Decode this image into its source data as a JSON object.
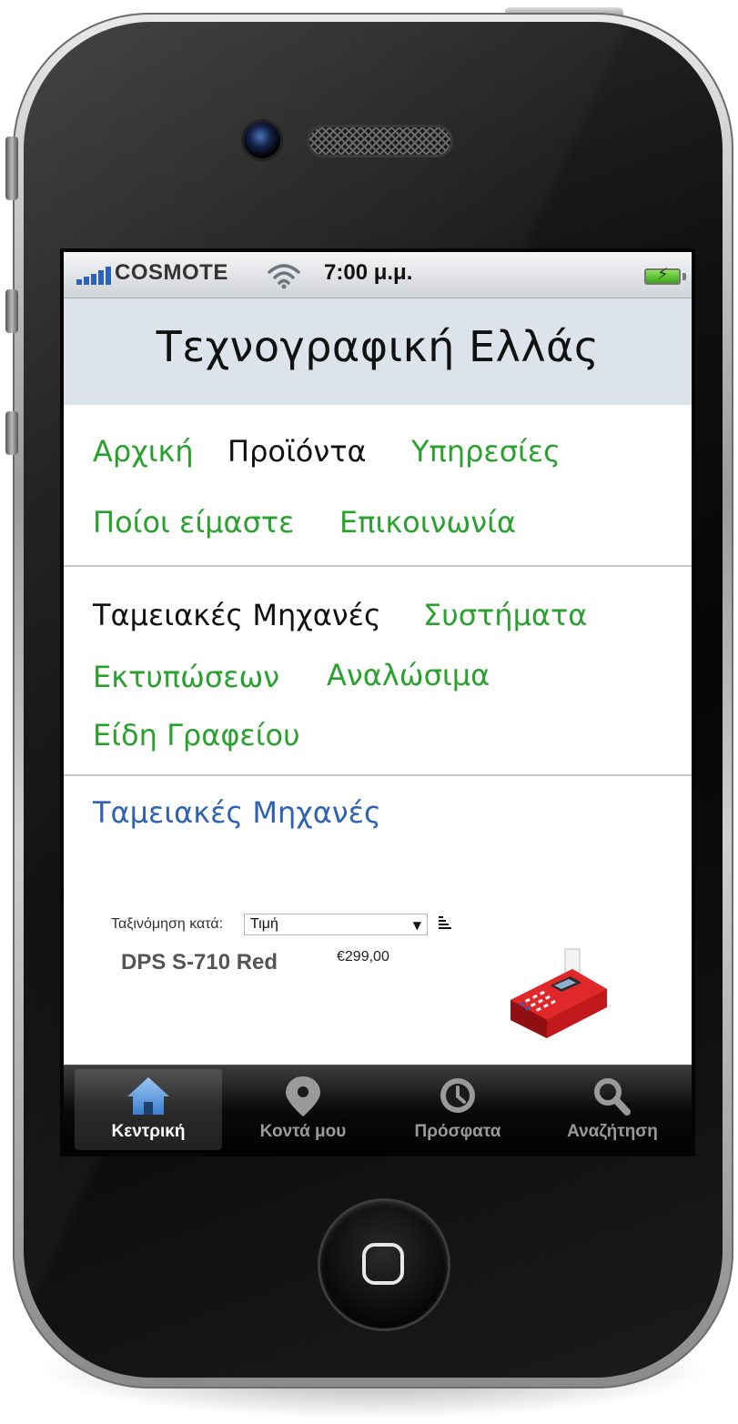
{
  "status_bar": {
    "carrier": "COSMOTE",
    "time": "7:00 μ.μ."
  },
  "header": {
    "title": "Τεχνογραφική Ελλάς"
  },
  "main_nav": [
    {
      "label": "Αρχική",
      "active": false
    },
    {
      "label": "Προϊόντα",
      "active": true
    },
    {
      "label": "Υπηρεσίες",
      "active": false
    },
    {
      "label": "Ποίοι είμαστε",
      "active": false
    },
    {
      "label": "Επικοινωνία",
      "active": false
    }
  ],
  "category_nav": [
    {
      "label": "Ταμειακές Μηχανές",
      "active": true
    },
    {
      "label": "Συστήματα",
      "active": false
    },
    {
      "label": "Εκτυπώσεων",
      "active": false
    },
    {
      "label": "Αναλώσιμα",
      "active": false
    },
    {
      "label": "Είδη Γραφείου",
      "active": false
    }
  ],
  "section": {
    "title": "Ταμειακές Μηχανές"
  },
  "sort": {
    "label": "Ταξινόμηση κατά:",
    "selected": "Τιμή"
  },
  "products": [
    {
      "name": "DPS S-710 Red",
      "price": "€299,00"
    }
  ],
  "tab_bar": {
    "tabs": [
      {
        "label": "Κεντρική",
        "icon": "home-icon",
        "selected": true
      },
      {
        "label": "Κοντά μου",
        "icon": "location-pin-icon",
        "selected": false
      },
      {
        "label": "Πρόσφατα",
        "icon": "clock-icon",
        "selected": false
      },
      {
        "label": "Αναζήτηση",
        "icon": "search-icon",
        "selected": false
      }
    ]
  },
  "colors": {
    "link_green": "#2aa12f",
    "section_blue": "#2f62b0",
    "header_bg": "#dde3ea"
  }
}
